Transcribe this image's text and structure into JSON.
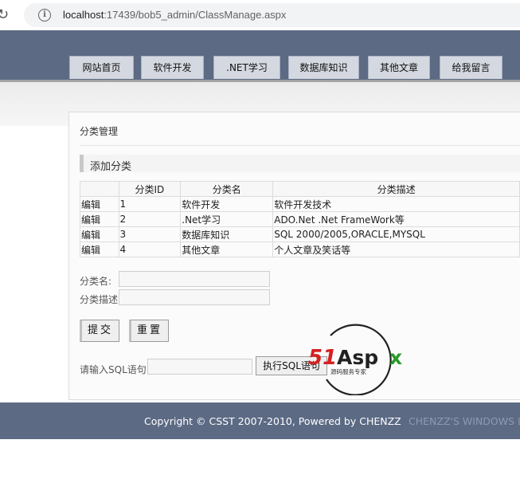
{
  "browser": {
    "url_host": "localhost",
    "url_rest": ":17439/bob5_admin/ClassManage.aspx"
  },
  "nav": {
    "items": [
      {
        "label": "网站首页"
      },
      {
        "label": "软件开发"
      },
      {
        "label": ".NET学习"
      },
      {
        "label": "数据库知识"
      },
      {
        "label": "其他文章"
      },
      {
        "label": "给我留言"
      }
    ]
  },
  "panel": {
    "title": "分类管理",
    "section_title": "添加分类"
  },
  "table": {
    "headers": [
      "",
      "分类ID",
      "分类名",
      "分类描述"
    ],
    "rows": [
      {
        "action": "编辑",
        "id": "1",
        "name": "软件开发",
        "desc": "软件开发技术"
      },
      {
        "action": "编辑",
        "id": "2",
        "name": ".Net学习",
        "desc": "ADO.Net .Net FrameWork等"
      },
      {
        "action": "编辑",
        "id": "3",
        "name": "数据库知识",
        "desc": "SQL 2000/2005,ORACLE,MYSQL"
      },
      {
        "action": "编辑",
        "id": "4",
        "name": "其他文章",
        "desc": "个人文章及笑话等"
      }
    ]
  },
  "form": {
    "name_label": "分类名:",
    "name_value": "",
    "desc_label": "分类描述",
    "desc_value": "",
    "submit_label": "提交",
    "reset_label": "重置",
    "sql_label": "请输入SQL语句",
    "sql_value": "",
    "sql_button": "执行SQL语句"
  },
  "watermark": {
    "brand": "51Aspx",
    "tagline": "源码服务专家"
  },
  "footer": {
    "copyright": "Copyright © CSST 2007-2010, Powered by CHENZZ",
    "brand": "CHENZZ'S WINDOWS L"
  }
}
